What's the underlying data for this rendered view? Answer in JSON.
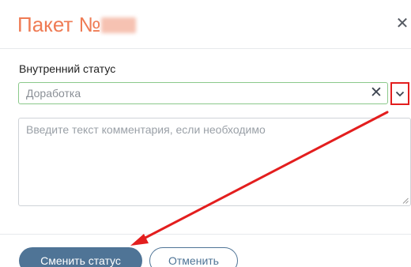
{
  "dialog": {
    "title": "Пакет №",
    "close_icon": "close-icon"
  },
  "status": {
    "label": "Внутренний статус",
    "value": "Доработка",
    "clear_icon": "clear-icon",
    "dropdown_icon": "chevron-down-icon",
    "border_color": "#8bc98b"
  },
  "comment": {
    "placeholder": "Введите текст комментария, если необходимо"
  },
  "actions": {
    "submit_label": "Сменить статус",
    "cancel_label": "Отменить"
  },
  "annotation": {
    "highlight_color": "#e31e1e",
    "arrow_color": "#e31e1e"
  },
  "colors": {
    "title": "#ef7b54",
    "primary": "#4f7496"
  }
}
